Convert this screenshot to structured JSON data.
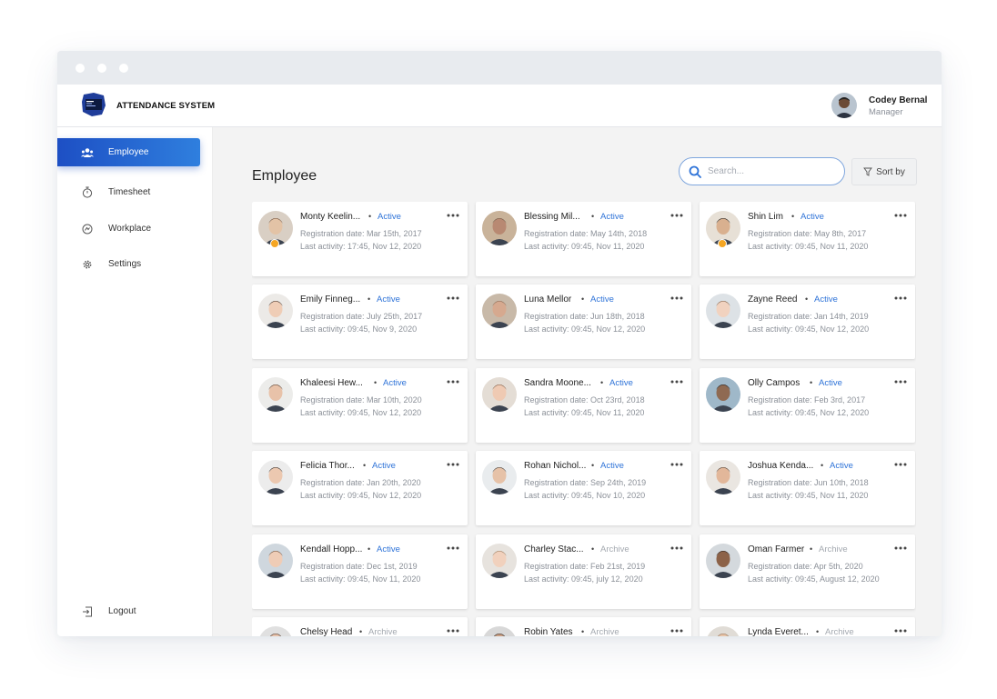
{
  "app": {
    "title": "ATTENDANCE SYSTEM",
    "logo_icon": "attendance-logo"
  },
  "user": {
    "name": "Codey Bernal",
    "role": "Manager"
  },
  "sidebar": {
    "items": [
      {
        "label": "Employee",
        "icon": "users-icon",
        "active": true
      },
      {
        "label": "Timesheet",
        "icon": "stopwatch-icon",
        "active": false
      },
      {
        "label": "Workplace",
        "icon": "workplace-icon",
        "active": false
      },
      {
        "label": "Settings",
        "icon": "gear-icon",
        "active": false
      }
    ],
    "logout": {
      "label": "Logout",
      "icon": "logout-icon"
    }
  },
  "main": {
    "title": "Employee",
    "search": {
      "placeholder": "Search...",
      "value": ""
    },
    "sort": {
      "label": "Sort by",
      "icon": "filter-icon"
    }
  },
  "colors": {
    "accent": "#2E73D8",
    "active_status": "#2E73D8",
    "archive_status": "#A4A9B0",
    "badge": "#F5A623"
  },
  "employees": [
    {
      "name": "Monty Keelin...",
      "status": "Active",
      "reg": "Registration date: Mar 15th, 2017",
      "last": "Last activity: 17:45, Nov 12, 2020",
      "badge": true
    },
    {
      "name": "Blessing Mil...",
      "status": "Active",
      "reg": "Registration date: May 14th, 2018",
      "last": "Last activity: 09:45, Nov 11, 2020",
      "badge": false
    },
    {
      "name": "Shin Lim",
      "status": "Active",
      "reg": "Registration date: May 8th, 2017",
      "last": "Last activity: 09:45, Nov 11, 2020",
      "badge": true
    },
    {
      "name": "Emily Finneg...",
      "status": "Active",
      "reg": "Registration date: July 25th, 2017",
      "last": "Last activity: 09:45, Nov 9, 2020",
      "badge": false
    },
    {
      "name": "Luna Mellor",
      "status": "Active",
      "reg": "Registration date: Jun 18th, 2018",
      "last": "Last activity: 09:45, Nov 12, 2020",
      "badge": false
    },
    {
      "name": "Zayne Reed",
      "status": "Active",
      "reg": "Registration date: Jan 14th, 2019",
      "last": "Last activity: 09:45, Nov 12, 2020",
      "badge": false
    },
    {
      "name": "Khaleesi Hew...",
      "status": "Active",
      "reg": "Registration date: Mar 10th, 2020",
      "last": "Last activity: 09:45, Nov 12, 2020",
      "badge": false
    },
    {
      "name": "Sandra Moone...",
      "status": "Active",
      "reg": "Registration date: Oct 23rd, 2018",
      "last": "Last activity: 09:45, Nov 11, 2020",
      "badge": false
    },
    {
      "name": "Olly Campos",
      "status": "Active",
      "reg": "Registration date: Feb 3rd, 2017",
      "last": "Last activity: 09:45, Nov 12, 2020",
      "badge": false
    },
    {
      "name": "Felicia Thor...",
      "status": "Active",
      "reg": "Registration date: Jan 20th, 2020",
      "last": "Last activity: 09:45, Nov 12, 2020",
      "badge": false
    },
    {
      "name": "Rohan Nichol...",
      "status": "Active",
      "reg": "Registration date: Sep 24th, 2019",
      "last": "Last activity: 09:45, Nov 10, 2020",
      "badge": false
    },
    {
      "name": "Joshua Kenda...",
      "status": "Active",
      "reg": "Registration date: Jun 10th, 2018",
      "last": "Last activity: 09:45, Nov 11, 2020",
      "badge": false
    },
    {
      "name": "Kendall Hopp...",
      "status": "Active",
      "reg": "Registration date: Dec 1st, 2019",
      "last": "Last activity: 09:45, Nov 11, 2020",
      "badge": false
    },
    {
      "name": "Charley Stac...",
      "status": "Archive",
      "reg": "Registration date: Feb 21st, 2019",
      "last": "Last activity: 09:45, july 12, 2020",
      "badge": false
    },
    {
      "name": "Oman Farmer",
      "status": "Archive",
      "reg": "Registration date: Apr 5th, 2020",
      "last": "Last activity: 09:45, August 12, 2020",
      "badge": false
    },
    {
      "name": "Chelsy Head",
      "status": "Archive",
      "reg": "",
      "last": "",
      "badge": false
    },
    {
      "name": "Robin Yates",
      "status": "Archive",
      "reg": "",
      "last": "",
      "badge": false
    },
    {
      "name": "Lynda Everet...",
      "status": "Archive",
      "reg": "",
      "last": "",
      "badge": false
    }
  ]
}
